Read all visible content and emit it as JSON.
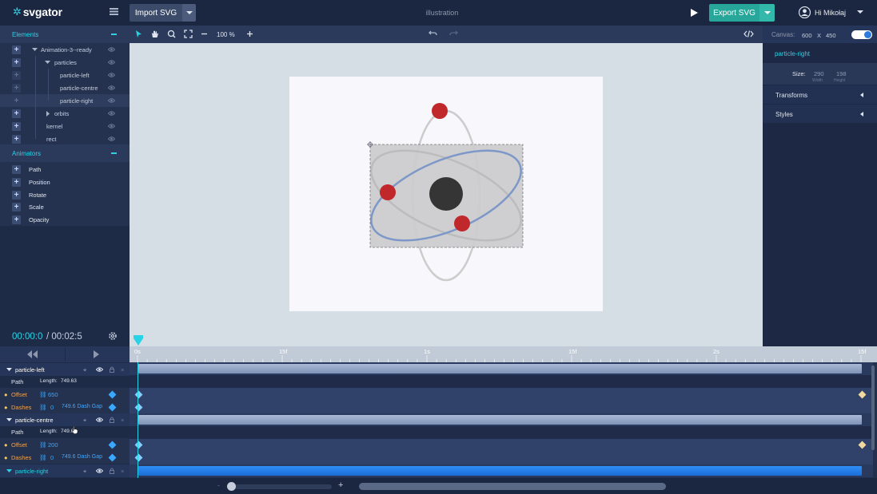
{
  "app": {
    "logo": "svgator",
    "doc_title": "illustration",
    "user": "Hi Mikołaj"
  },
  "toolbar": {
    "import_label": "Import SVG",
    "export_label": "Export SVG",
    "zoom": "100 %"
  },
  "elements_panel": {
    "title": "Elements",
    "items": [
      {
        "label": "Animation-3--ready"
      },
      {
        "label": "particles"
      },
      {
        "label": "particle-left"
      },
      {
        "label": "particle-centre"
      },
      {
        "label": "particle-right"
      },
      {
        "label": "orbits"
      },
      {
        "label": "kernel"
      },
      {
        "label": "rect"
      }
    ]
  },
  "animators_panel": {
    "title": "Animators",
    "items": [
      {
        "label": "Path"
      },
      {
        "label": "Position"
      },
      {
        "label": "Rotate"
      },
      {
        "label": "Scale"
      },
      {
        "label": "Opacity"
      }
    ]
  },
  "time": {
    "current": "00:00:0",
    "sep": " / ",
    "total": "00:02:5"
  },
  "canvas_props": {
    "label": "Canvas:",
    "width": "600",
    "x": "X",
    "height": "450"
  },
  "properties": {
    "selected": "particle-right",
    "size_label": "Size:",
    "width": "290",
    "height": "198",
    "width_sub": "Width",
    "height_sub": "Height",
    "sections": [
      {
        "label": "Transforms"
      },
      {
        "label": "Styles"
      }
    ]
  },
  "ruler": [
    "0s",
    "15f",
    "1s",
    "15f",
    "2s",
    "15f"
  ],
  "timeline": {
    "tracks": [
      {
        "name": "particle-left",
        "path_label": "Path",
        "length_label": "Length:",
        "length": "749.63",
        "offset_label": "Offset",
        "offset": "650",
        "dashes_label": "Dashes",
        "dash_zero": "0",
        "dash_value": "749.6 Dash  Gap"
      },
      {
        "name": "particle-centre",
        "path_label": "Path",
        "length_label": "Length:",
        "length": "749.6",
        "offset_label": "Offset",
        "offset": "200",
        "dashes_label": "Dashes",
        "dash_zero": "0",
        "dash_value": "749.6 Dash  Gap"
      },
      {
        "name": "particle-right"
      }
    ]
  },
  "colors": {
    "accent": "#29d3e6",
    "export": "#27a79a",
    "particle": "#c0282b",
    "orbit": "#7d98c8"
  }
}
